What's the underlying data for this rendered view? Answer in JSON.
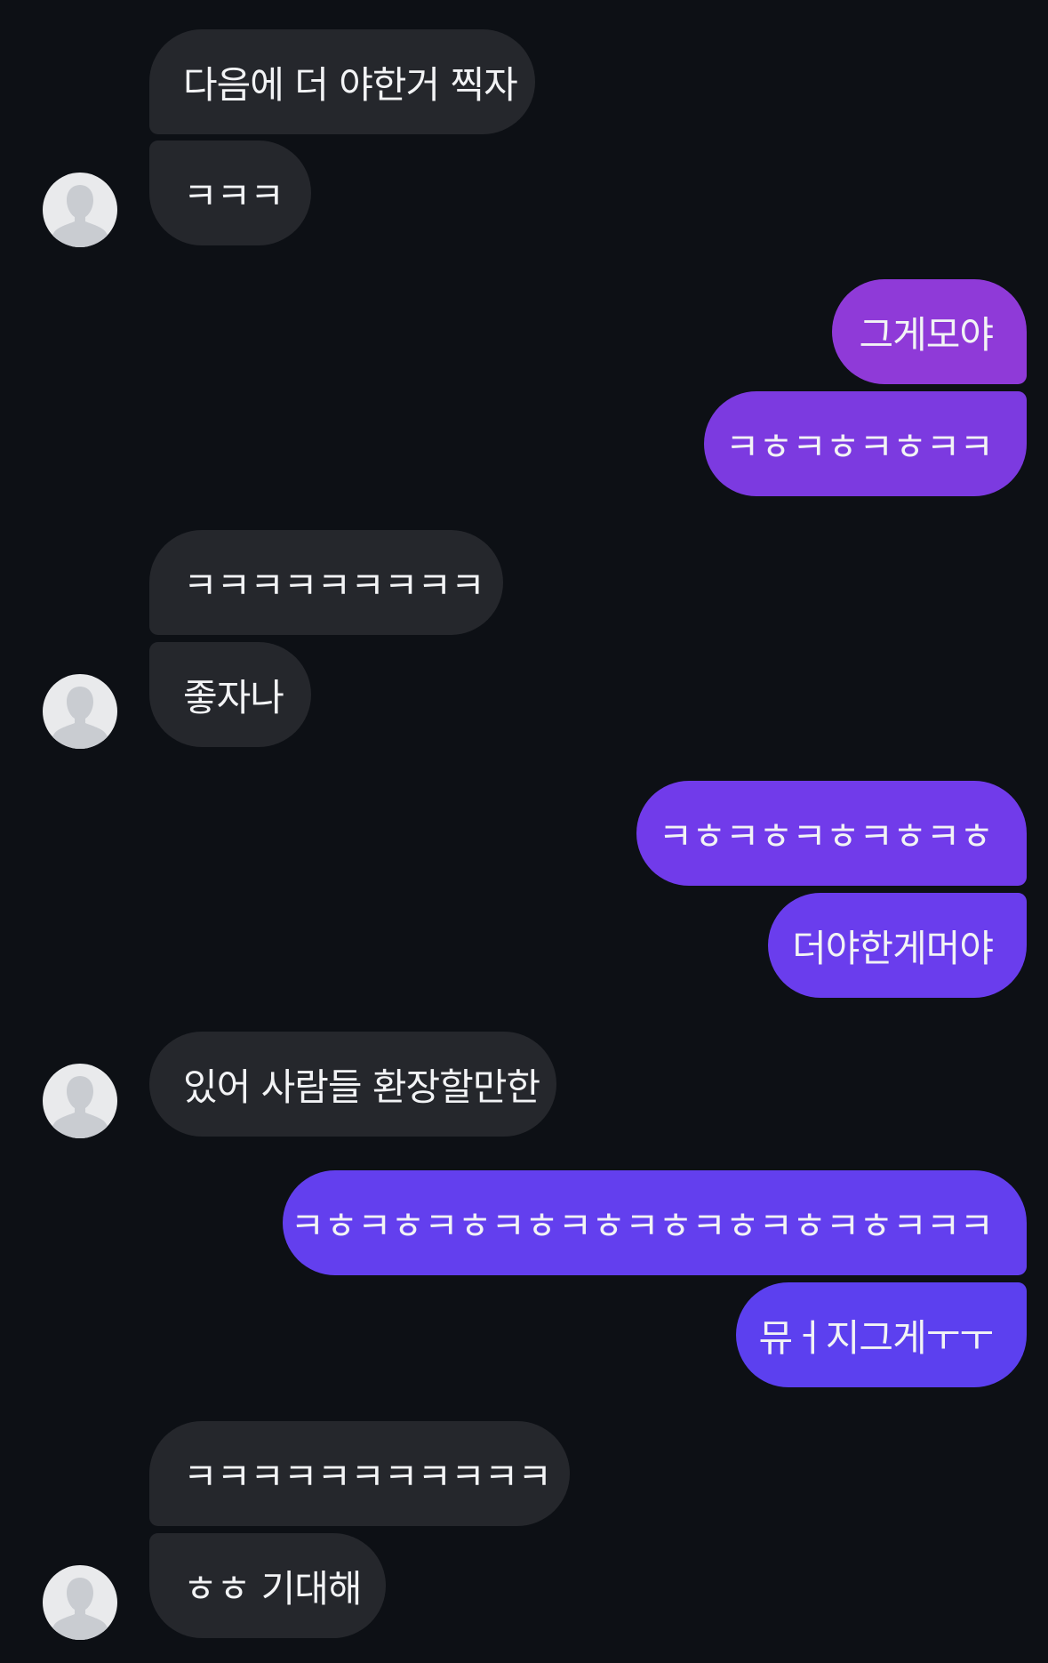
{
  "colors": {
    "background": "#0d1015",
    "incoming_bubble": "#25272c",
    "outgoing_bubble_1": "#8f3ad8",
    "outgoing_bubble_2": "#7c3ae0",
    "outgoing_bubble_3": "#713bea",
    "outgoing_bubble_4": "#6a3ded",
    "outgoing_bubble_5": "#633fee",
    "outgoing_bubble_6": "#5c40ef",
    "avatar_bg": "#e9eaec",
    "avatar_figure": "#c9ccd1"
  },
  "messages": [
    {
      "side": "incoming",
      "text": "다음에 더 야한거 찍자"
    },
    {
      "side": "incoming",
      "text": "ㅋㅋㅋ"
    },
    {
      "side": "outgoing",
      "text": "그게모야"
    },
    {
      "side": "outgoing",
      "text": "ㅋㅎㅋㅎㅋㅎㅋㅋ"
    },
    {
      "side": "incoming",
      "text": "ㅋㅋㅋㅋㅋㅋㅋㅋㅋ"
    },
    {
      "side": "incoming",
      "text": "좋자나"
    },
    {
      "side": "outgoing",
      "text": "ㅋㅎㅋㅎㅋㅎㅋㅎㅋㅎ"
    },
    {
      "side": "outgoing",
      "text": "더야한게머야"
    },
    {
      "side": "incoming",
      "text": "있어 사람들 환장할만한"
    },
    {
      "side": "outgoing",
      "text": "ㅋㅎㅋㅎㅋㅎㅋㅎㅋㅎㅋㅎㅋㅎㅋㅎㅋㅎㅋㅋㅋ"
    },
    {
      "side": "outgoing",
      "text": "뮤ㅓ지그게ㅜㅜ"
    },
    {
      "side": "incoming",
      "text": "ㅋㅋㅋㅋㅋㅋㅋㅋㅋㅋㅋ"
    },
    {
      "side": "incoming",
      "text": "ㅎㅎ 기대해"
    }
  ],
  "avatar_icon": "default-user-avatar-icon"
}
